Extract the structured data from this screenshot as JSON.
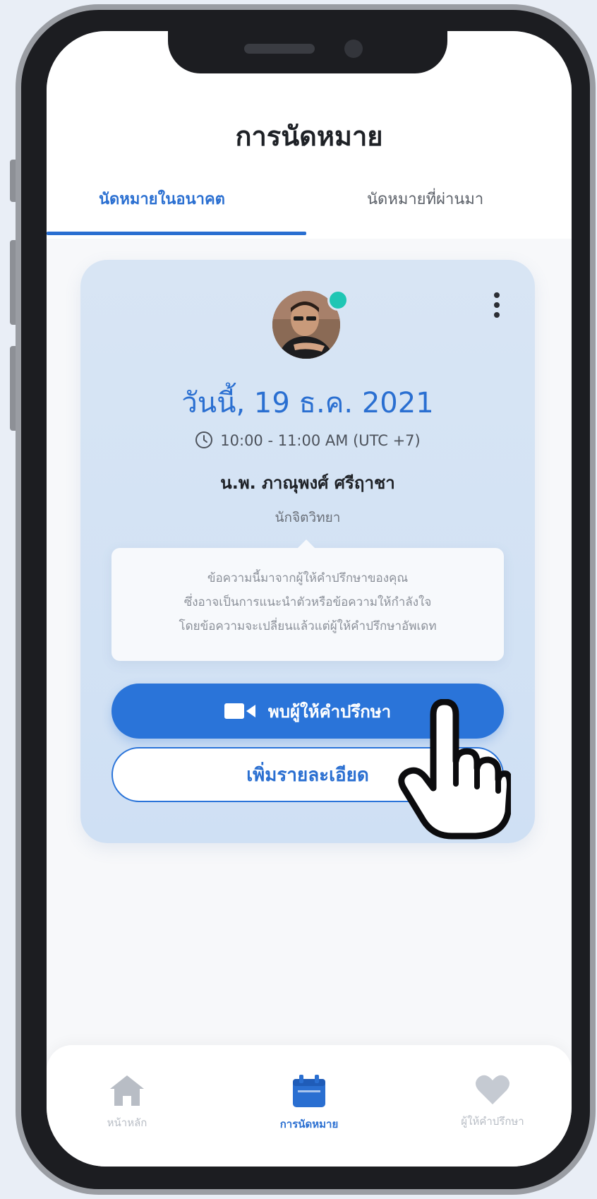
{
  "screen": {
    "title": "การนัดหมาย"
  },
  "tabs": [
    {
      "label": "นัดหมายในอนาคต",
      "active": true
    },
    {
      "label": "นัดหมายที่ผ่านมา",
      "active": false
    }
  ],
  "appointment": {
    "date": "วันนี้, 19 ธ.ค. 2021",
    "time": "10:00 - 11:00 AM (UTC +7)",
    "doctor_name": "น.พ. ภาณุพงศ์ ศรีฤาชา",
    "doctor_role": "นักจิตวิทยา",
    "online_status_color": "#1fc6b4",
    "message_lines": [
      "ข้อความนี้มาจากผู้ให้คำปรึกษาของคุณ",
      "ซึ่งอาจเป็นการแนะนำตัวหรือข้อความให้กำลังใจ",
      "โดยข้อความจะเปลี่ยนแล้วแต่ผู้ให้คำปรึกษาอัพเดท"
    ],
    "meet_button_label": "พบผู้ให้คำปรึกษา",
    "details_button_label": "เพิ่มรายละเอียด"
  },
  "bottom_nav": [
    {
      "label": "หน้าหลัก",
      "icon": "home-icon",
      "active": false
    },
    {
      "label": "การนัดหมาย",
      "icon": "calendar-icon",
      "active": true
    },
    {
      "label": "ผู้ให้คำปรึกษา",
      "icon": "heart-icon",
      "active": false
    }
  ],
  "colors": {
    "accent": "#2a6fd1",
    "button": "#2a74d9",
    "card_bg": "#d8e5f4"
  }
}
